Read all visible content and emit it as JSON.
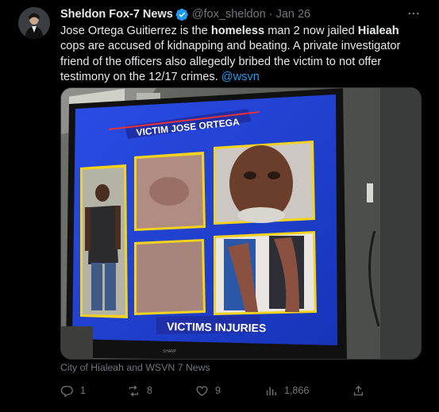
{
  "tweet": {
    "author_name": "Sheldon Fox-7 News",
    "handle": "@fox_sheldon",
    "separator": "·",
    "date": "Jan 26",
    "text_parts": [
      {
        "t": "Jose Ortega Guitierrez is the ",
        "style": "normal"
      },
      {
        "t": "homeless",
        "style": "bold"
      },
      {
        "t": " man 2 now jailed ",
        "style": "normal"
      },
      {
        "t": "Hialeah",
        "style": "bold"
      },
      {
        "t": " cops are accused of kidnapping and beating. A private investigator friend of the officers also allegedly bribed the victim to not offer testimony on the 12/17 crimes. ",
        "style": "normal"
      },
      {
        "t": "@wsvn",
        "style": "mention"
      }
    ],
    "media_credit": "City of Hialeah and WSVN 7 News",
    "media_title_top": "VICTIM JOSE ORTEGA",
    "media_title_bottom": "VICTIMS INJURIES",
    "tv_brand": "SHARP",
    "actions": {
      "replies": "1",
      "reposts": "8",
      "likes": "9",
      "views": "1,866"
    }
  },
  "colors": {
    "accent": "#1d9bf0",
    "muted": "#71767b",
    "screen_blue": "#1f3fd0",
    "frame_yellow": "#f3d31e"
  }
}
